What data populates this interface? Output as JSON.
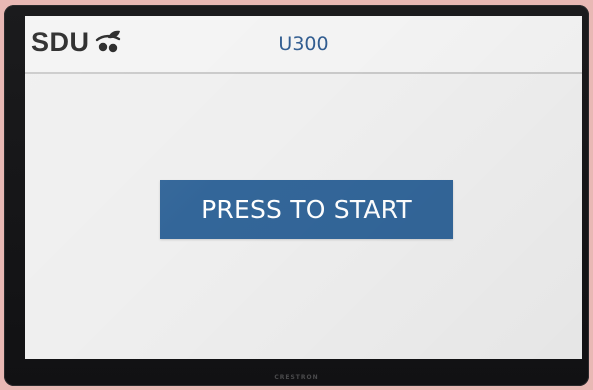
{
  "header": {
    "logo_text": "SDU",
    "logo_icon": "sdu-leaf-logo",
    "room_title": "U300"
  },
  "main": {
    "start_button_label": "PRESS TO START"
  },
  "device": {
    "brand_text": "CRESTRON"
  },
  "colors": {
    "accent": "#336699",
    "title": "#2f5b8f",
    "background": "#efefef",
    "bezel": "#151517"
  }
}
